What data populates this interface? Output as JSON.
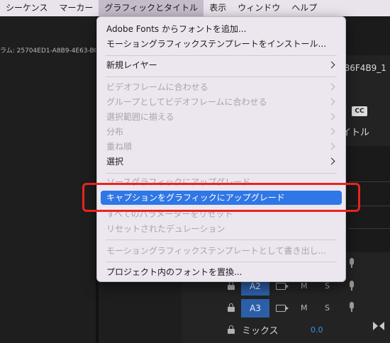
{
  "menubar": {
    "items": [
      "シーケンス",
      "マーカー",
      "グラフィックとタイトル",
      "表示",
      "ウィンドウ",
      "ヘルプ"
    ],
    "active_index": 2
  },
  "left_panel": {
    "id_text": "ラム: 25704ED1-A8B9-4E63-BCBF-"
  },
  "right_panel": {
    "id_text": "786F4B9_1",
    "cc_badge": "CC",
    "title_fragment": "イトル"
  },
  "tracks": [
    {
      "label": "A2",
      "m": "M",
      "s": "S"
    },
    {
      "label": "A3",
      "m": "M",
      "s": "S"
    }
  ],
  "mix": {
    "label": "ミックス",
    "value": "0.0"
  },
  "dropdown": {
    "items": {
      "add_fonts": "Adobe Fonts からフォントを追加...",
      "install_template": "モーショングラフィックステンプレートをインストール...",
      "new_layer": "新規レイヤー",
      "fit_video_frame": "ビデオフレームに合わせる",
      "fit_group_video_frame": "グループとしてビデオフレームに合わせる",
      "align_selection": "選択範囲に揃える",
      "distribute": "分布",
      "arrange": "重ね順",
      "select": "選択",
      "upgrade_source": "ソースグラフィックにアップグレード",
      "upgrade_caption": "キャプションをグラフィックにアップグレード",
      "reset_all_params": "すべてのパラメーターをリセット",
      "reset_duration": "リセットされたデュレーション",
      "export_template": "モーショングラフィックステンプレートとして書き出し...",
      "replace_fonts": "プロジェクト内のフォントを置換..."
    }
  },
  "colors": {
    "menubar_bg": "#e9e3ec",
    "highlight": "#2f77e6",
    "annotation_box": "#e8241f",
    "track_label": "#2c5fa8",
    "mix_value": "#3e8ee8"
  }
}
